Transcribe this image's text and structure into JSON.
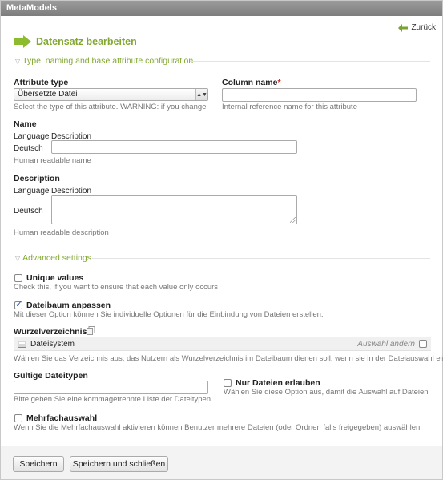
{
  "window": {
    "title": "MetaModels"
  },
  "header": {
    "title": "Datensatz bearbeiten",
    "back_label": "Zurück"
  },
  "section1": {
    "legend": "Type, naming and base attribute configuration"
  },
  "attribute_type": {
    "label": "Attribute type",
    "value": "Übersetzte Datei",
    "help": "Select the type of this attribute. WARNING: if you change"
  },
  "column_name": {
    "label": "Column name",
    "required_mark": "*",
    "value": "",
    "help": "Internal reference name for this attribute"
  },
  "name": {
    "label": "Name",
    "col_language": "Language",
    "col_description": "Description",
    "row_language": "Deutsch",
    "value": "",
    "help": "Human readable name"
  },
  "description": {
    "label": "Description",
    "col_language": "Language",
    "col_description": "Description",
    "row_language": "Deutsch",
    "value": "",
    "help": "Human readable description"
  },
  "section2": {
    "legend": "Advanced settings"
  },
  "unique_values": {
    "label": "Unique values",
    "checked": false,
    "help": "Check this, if you want to ensure that each value only occurs"
  },
  "file_tree": {
    "label": "Dateibaum anpassen",
    "checked": true,
    "help": "Mit dieser Option können Sie individuelle Optionen für die Einbindung von Dateien erstellen."
  },
  "root_dir": {
    "label": "Wurzelverzeichnis",
    "tree_item": "Dateisystem",
    "change_label": "Auswahl ändern",
    "help": "Wählen Sie das Verzeichnis aus, das Nutzern als Wurzelverzeichnis im Dateibaum dienen soll, wenn sie in der Dateiauswahl eine"
  },
  "file_types": {
    "label": "Gültige Dateitypen",
    "value": "",
    "help": "Bitte geben Sie eine kommagetrennte Liste der Dateitypen"
  },
  "files_only": {
    "label": "Nur Dateien erlauben",
    "checked": false,
    "help": "Wählen Sie diese Option aus, damit die Auswahl auf Dateien"
  },
  "multi_select": {
    "label": "Mehrfachauswahl",
    "checked": false,
    "help": "Wenn Sie die Mehrfachauswahl aktivieren können Benutzer mehrere Dateien (oder Ordner, falls freigegeben) auswählen."
  },
  "footer": {
    "save_label": "Speichern",
    "save_close_label": "Speichern und schließen"
  },
  "colors": {
    "accent_green": "#82a832",
    "title_bar": "#8a8a8a",
    "required": "#cc2a2a",
    "check_blue": "#2a57b5"
  }
}
